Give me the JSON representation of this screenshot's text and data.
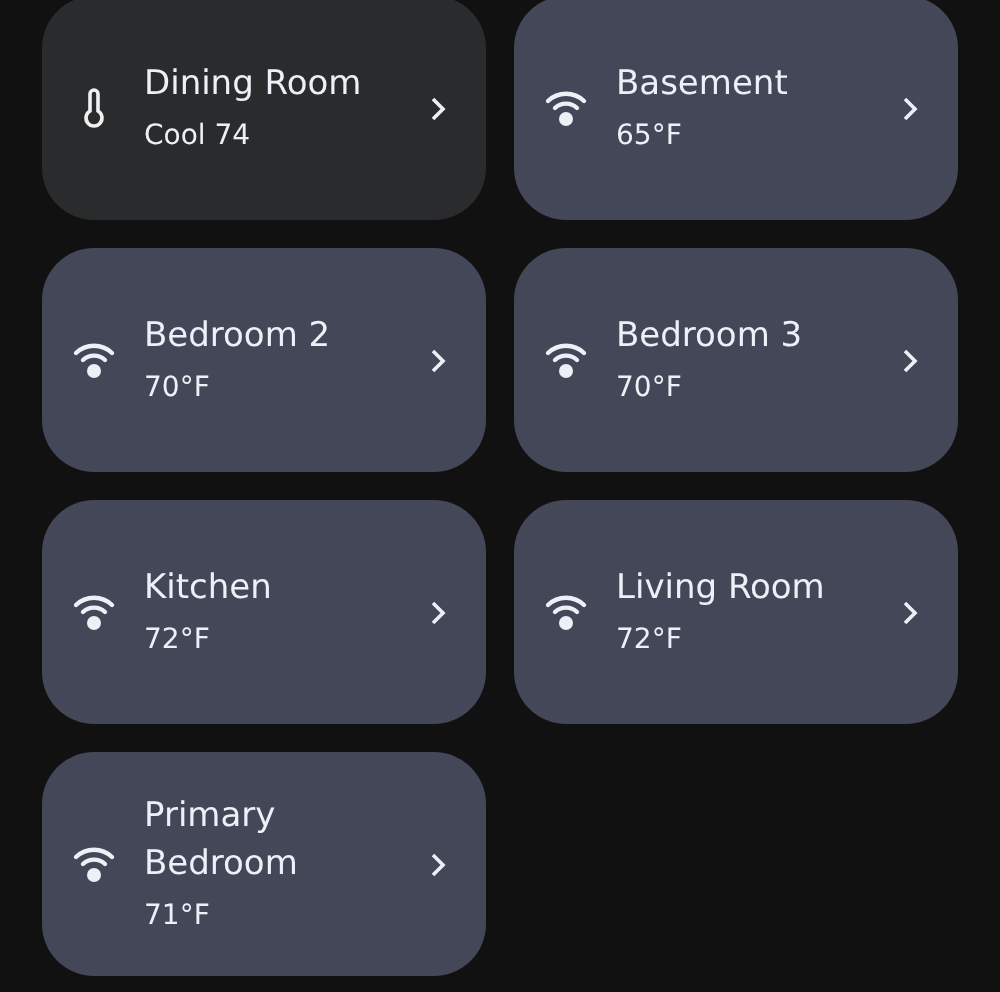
{
  "devices": [
    {
      "kind": "thermostat",
      "name": "Dining Room",
      "reading": "Cool 74"
    },
    {
      "kind": "sensor",
      "name": "Basement",
      "reading": "65°F"
    },
    {
      "kind": "sensor",
      "name": "Bedroom 2",
      "reading": "70°F"
    },
    {
      "kind": "sensor",
      "name": "Bedroom 3",
      "reading": "70°F"
    },
    {
      "kind": "sensor",
      "name": "Kitchen",
      "reading": "72°F"
    },
    {
      "kind": "sensor",
      "name": "Living Room",
      "reading": "72°F"
    },
    {
      "kind": "sensor",
      "name": "Primary Bedroom",
      "reading": "71°F"
    }
  ]
}
